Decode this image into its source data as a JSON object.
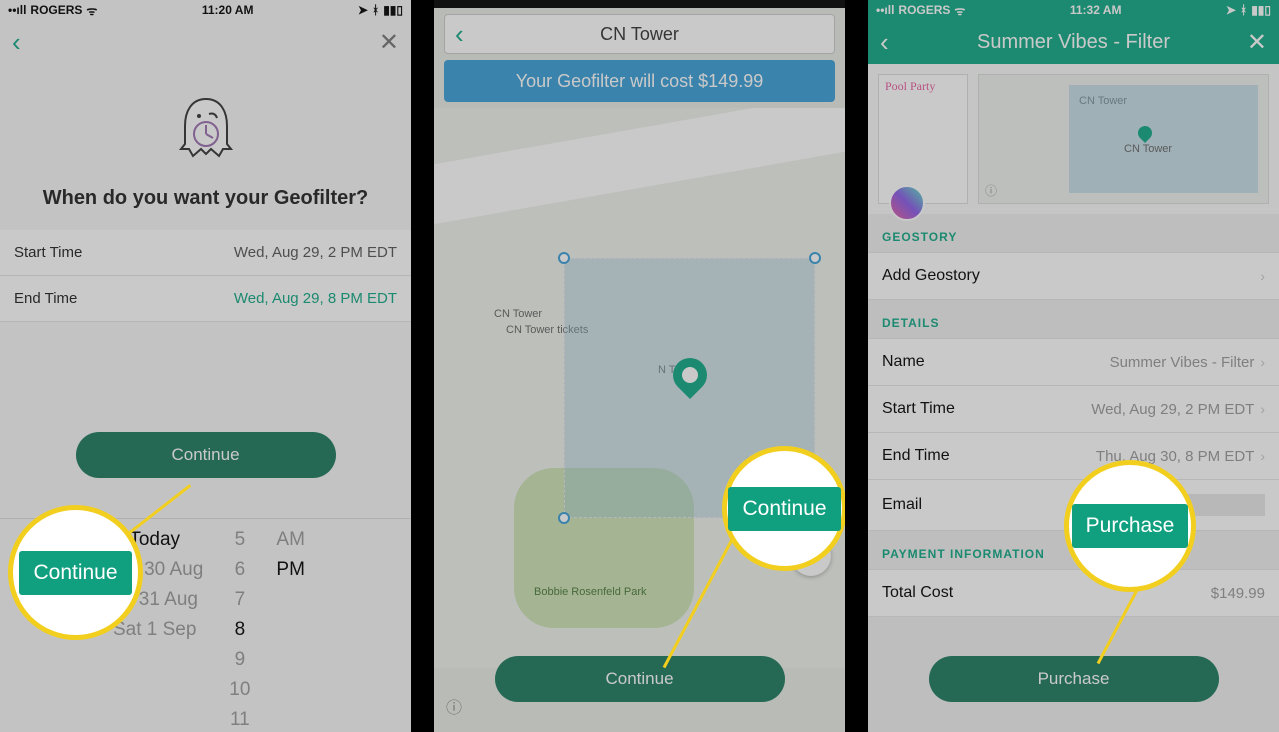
{
  "status": {
    "carrier": "ROGERS",
    "time1": "11:20 AM",
    "time3": "11:32 AM"
  },
  "screen1": {
    "question": "When do you want your Geofilter?",
    "start_label": "Start Time",
    "start_value": "Wed, Aug 29, 2 PM EDT",
    "end_label": "End Time",
    "end_value": "Wed, Aug 29, 8 PM EDT",
    "continue": "Continue",
    "picker": {
      "days": [
        "",
        "",
        "Today",
        "Thu 30 Aug",
        "Fri 31 Aug",
        "Sat 1 Sep"
      ],
      "hours": [
        "5",
        "6",
        "7",
        "8",
        "9",
        "10",
        "11"
      ],
      "ampm": [
        "AM",
        "PM"
      ],
      "sel_day_idx": 2,
      "sel_hour_idx": 3,
      "sel_ampm_idx": 1
    },
    "callout": "Continue"
  },
  "screen2": {
    "location": "CN Tower",
    "cost_text": "Your Geofilter will cost $149.99",
    "labels": {
      "cn": "CN Tower",
      "cnt": "CN Tower tickets",
      "ntower": "N Tower",
      "park": "Bobbie Rosenfeld Park"
    },
    "continue": "Continue",
    "callout": "Continue"
  },
  "screen3": {
    "title": "Summer Vibes - Filter",
    "pool_party": "Pool Party",
    "map_labels": {
      "cn": "CN Tower",
      "cn2": "CN Tower"
    },
    "geostory_h": "GEOSTORY",
    "add_geostory": "Add Geostory",
    "details_h": "DETAILS",
    "name_l": "Name",
    "name_v": "Summer Vibes - Filter",
    "start_l": "Start Time",
    "start_v": "Wed, Aug 29, 2 PM EDT",
    "end_l": "End Time",
    "end_v": "Thu, Aug 30, 8 PM EDT",
    "email_l": "Email",
    "payment_h": "PAYMENT INFORMATION",
    "total_l": "Total Cost",
    "total_v": "$149.99",
    "purchase": "Purchase",
    "callout": "Purchase"
  }
}
